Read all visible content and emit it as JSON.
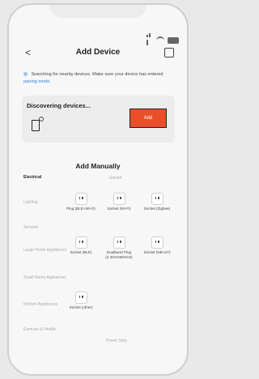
{
  "header": {
    "back_glyph": "<",
    "title": "Add Device"
  },
  "hint": {
    "text_before": "Searching for nearby devices. Make sure your device has entered ",
    "link": "pairing mode",
    "text_after": "."
  },
  "discover": {
    "label": "Discovering devices...",
    "add_label": "Add"
  },
  "manual": {
    "title": "Add Manually",
    "section_socket": "Socket",
    "section_power_strip": "Power Strip",
    "categories": [
      {
        "label": "Electrical",
        "active": true
      },
      {
        "label": "Lighting",
        "active": false
      },
      {
        "label": "Sensors",
        "active": false
      },
      {
        "label": "Large Home Appliances",
        "active": false
      },
      {
        "label": "Small Home Appliances",
        "active": false
      },
      {
        "label": "Kitchen Appliances",
        "active": false
      },
      {
        "label": "Exercise & Health",
        "active": false
      }
    ],
    "tiles": [
      {
        "label": "Plug (BLE+Wi-Fi)"
      },
      {
        "label": "Socket (Wi-Fi)"
      },
      {
        "label": "Socket (Zigbee)"
      },
      {
        "label": "Socket (BLE)"
      },
      {
        "label": "Dualband Plug (2.4GHz&5GHz)"
      },
      {
        "label": "Socket (NB-IoT)"
      },
      {
        "label": "Socket (other)"
      }
    ]
  },
  "colors": {
    "accent": "#e8502a",
    "link": "#2f7fd6"
  }
}
